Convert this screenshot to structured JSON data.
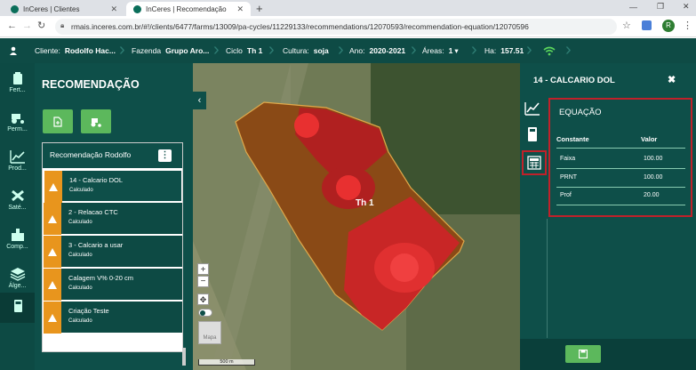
{
  "browser": {
    "tabs": [
      {
        "title": "InCeres | Clientes"
      },
      {
        "title": "InCeres | Recomendação"
      }
    ],
    "new_tab": "+",
    "url": "rmais.inceres.com.br/#!/clients/6477/farms/13009/pa-cycles/11229133/recommendations/12070593/recommendation-equation/12070596",
    "profile_initial": "R"
  },
  "header": {
    "cliente_label": "Cliente:",
    "cliente_value": "Rodolfo Hac...",
    "fazenda_label": "Fazenda",
    "fazenda_value": "Grupo Aro...",
    "ciclo_label": "Ciclo",
    "ciclo_value": "Th 1",
    "cultura_label": "Cultura:",
    "cultura_value": "soja",
    "ano_label": "Ano:",
    "ano_value": "2020-2021",
    "areas_label": "Áreas:",
    "areas_value": "1",
    "ha_label": "Ha:",
    "ha_value": "157.51"
  },
  "rail": {
    "items": [
      {
        "label": "Fert...",
        "icon": "fertilizer-icon"
      },
      {
        "label": "Perm...",
        "icon": "tractor-icon"
      },
      {
        "label": "Prod...",
        "icon": "chart-icon"
      },
      {
        "label": "Saté...",
        "icon": "satellite-icon"
      },
      {
        "label": "Comp...",
        "icon": "compare-icon"
      },
      {
        "label": "Álge...",
        "icon": "layers-icon"
      },
      {
        "label": "",
        "icon": "calculator-icon"
      }
    ]
  },
  "left_panel": {
    "title": "RECOMENDAÇÃO",
    "list_title": "Recomendação Rodolfo",
    "items": [
      {
        "name": "14 - Calcario DOL",
        "status": "Calculado"
      },
      {
        "name": "2 - Relacao CTC",
        "status": "Calculado"
      },
      {
        "name": "3 - Calcario a usar",
        "status": "Calculado"
      },
      {
        "name": "Calagem V% 0-20 cm",
        "status": "Calculado"
      },
      {
        "name": "Criação Teste",
        "status": "Calculado"
      }
    ]
  },
  "map": {
    "field_label": "Th 1",
    "scale_label": "500 m",
    "zoom_in": "+",
    "zoom_out": "−",
    "basemap_label": "Mapa"
  },
  "right_panel": {
    "title": "14 - CALCARIO DOL",
    "section_title": "EQUAÇÃO",
    "columns": [
      "Constante",
      "Valor"
    ],
    "rows": [
      {
        "constant": "Faixa",
        "value": "100.00"
      },
      {
        "constant": "PRNT",
        "value": "100.00"
      },
      {
        "constant": "Prof",
        "value": "20.00"
      }
    ]
  },
  "colors": {
    "header": "#0e4b45",
    "panel": "#0e4f49",
    "accent_green": "#5cb85c",
    "warning": "#e8951d",
    "highlight": "#c0212a"
  }
}
